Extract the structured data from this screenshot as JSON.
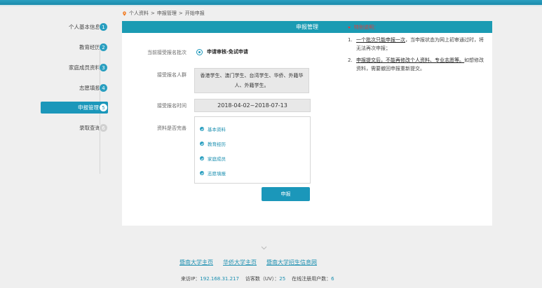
{
  "breadcrumb": {
    "items": [
      "个人资料",
      "申报管理",
      "开始申报"
    ],
    "separator": ">"
  },
  "sidebar": {
    "items": [
      {
        "label": "个人基本信息",
        "num": "1"
      },
      {
        "label": "教育经历",
        "num": "2"
      },
      {
        "label": "家庭成员资料",
        "num": "3"
      },
      {
        "label": "志愿填报",
        "num": "4"
      },
      {
        "label": "申报管理",
        "num": "5"
      },
      {
        "label": "录取查询",
        "num": "6"
      }
    ]
  },
  "panel": {
    "title": "申报管理",
    "batch_label": "当前接受报名批次",
    "batch_value": "申请审核-免试申请",
    "group_label": "接受报名人群",
    "group_line1": "香港学生、澳门学生、台湾学生、华侨、外籍华",
    "group_line2": "人、外籍学生。",
    "time_label": "接受报名时间",
    "time_value": "2018-04-02~2018-07-13",
    "complete_label": "资料是否完善",
    "checks": [
      "基本资料",
      "教育经历",
      "家庭成员",
      "志愿填报"
    ],
    "submit_label": "申报"
  },
  "notice": {
    "title": "特别说明：",
    "item1_num": "1.",
    "item1_underlined": "一个批次只能申报一次",
    "item1_rest": "，当申报状态为网上初审通过时，将无法再次申报；",
    "item2_num": "2.",
    "item2_underlined": "申报提交后，不能再修改个人资料、专业志愿等。",
    "item2_rest": "如想修改资料，需要撤回申报重新提交。"
  },
  "footer": {
    "links": [
      "暨南大学主页",
      "华侨大学主页",
      "暨南大学招生信息网"
    ],
    "ip_label": "来访IP：",
    "ip_value": "192.168.31.217",
    "visits_label": "访客数（UV）：",
    "visits_value": "25",
    "online_label": "在线注册用户数：",
    "online_value": "6"
  },
  "colors": {
    "accent": "#1b97ba",
    "header": "#1b9bb3",
    "notice": "#e03b3b"
  }
}
